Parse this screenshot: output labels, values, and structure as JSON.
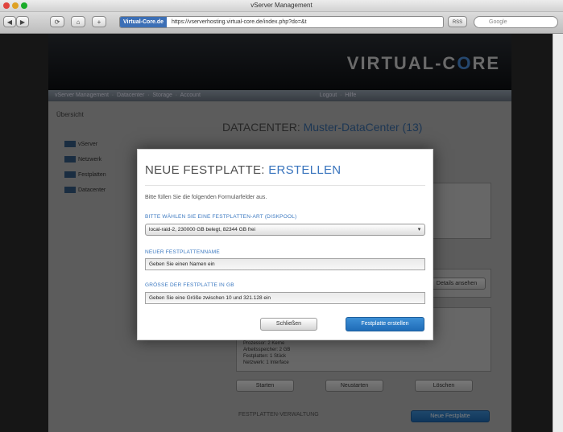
{
  "window": {
    "title": "vServer Management"
  },
  "toolbar": {
    "back_label": "◀",
    "forward_label": "▶",
    "reload_label": "⟳",
    "home_label": "⌂",
    "add_label": "+",
    "site_identity": "Virtual-Core.de",
    "url": "https://vserverhosting.virtual-core.de/index.php?do=&t",
    "rss_label": "RSS",
    "search_placeholder": "Google"
  },
  "page": {
    "logo_main": "VIRTUAL-C",
    "logo_accent": "O",
    "logo_end": "RE",
    "subnav_text": "vServer Management  ·  Datacenter  ·  Storage  ·  Account                                                                            Logout  ·  Hilfe",
    "sidebar_title": "Übersicht",
    "tree_items": [
      {
        "label": "vServer"
      },
      {
        "label": "Netzwerk"
      },
      {
        "label": "Festplatten"
      },
      {
        "label": "Datacenter"
      }
    ],
    "heading_prefix": "DATACENTER: ",
    "heading_name": "Muster-DataCenter (13)",
    "bg_text_block": "Prozessor: 2 Kerne\nArbeitsspeicher: 2 GB\nFestplatten: 1 Stück\nNetzwerk: 1 Interface",
    "bg_buttons": [
      "Starten",
      "Neustarten",
      "Löschen"
    ],
    "bg_footer_label": "FESTPLATTEN-VERWALTUNG",
    "bg_footer_button": "Neue Festplatte",
    "bg_side_button": "Details ansehen"
  },
  "modal": {
    "title_prefix": "NEUE FESTPLATTE: ",
    "title_action": "ERSTELLEN",
    "intro": "Bitte füllen Sie die folgenden Formularfelder aus.",
    "pool_label": "BITTE WÄHLEN SIE EINE FESTPLATTEN-ART (DISKPOOL)",
    "pool_value": "local-raid-2, 230000 GB belegt, 82344 GB frei",
    "name_label": "NEUER FESTPLATTENNAME",
    "name_placeholder": "Geben Sie einen Namen ein",
    "size_label": "GRÖSSE DER FESTPLATTE IN GB",
    "size_placeholder": "Geben Sie eine Größe zwischen 10 und 321.128 ein",
    "close_button": "Schließen",
    "create_button": "Festplatte erstellen"
  },
  "colors": {
    "accent_blue": "#3974bd",
    "primary_button": "#1f6cb7"
  }
}
